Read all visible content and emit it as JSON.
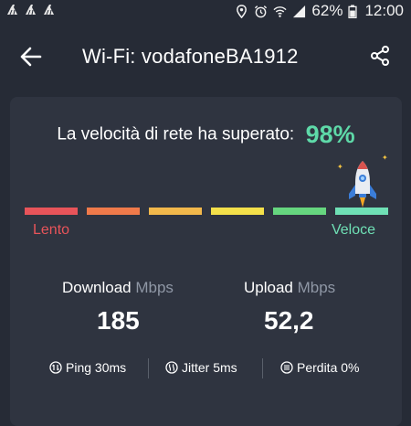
{
  "status_bar": {
    "notifications": [
      "cleaner-notification-icon",
      "cleaner-notification-icon",
      "cleaner-notification-icon"
    ],
    "icons": [
      "location-icon",
      "alarm-icon",
      "wifi-icon",
      "signal-icon"
    ],
    "battery": "62%",
    "time": "12:00"
  },
  "app_bar": {
    "title": "Wi-Fi: vodafoneBA1912",
    "back_icon": "back-arrow-icon",
    "share_icon": "share-icon"
  },
  "result": {
    "headline": "La velocità di rete ha superato:",
    "percentile": "98%",
    "meter": {
      "level": 0.98,
      "segment_colors": [
        "#e8545a",
        "#f07a4a",
        "#f2b84b",
        "#f4e04a",
        "#66d67f",
        "#6fe0b5"
      ]
    },
    "slow_label": "Lento",
    "fast_label": "Veloce"
  },
  "metrics": {
    "download": {
      "label": "Download",
      "unit": "Mbps",
      "value": "185"
    },
    "upload": {
      "label": "Upload",
      "unit": "Mbps",
      "value": "52,2"
    }
  },
  "stats": {
    "ping": {
      "icon": "ping-icon",
      "text": "Ping 30ms"
    },
    "jitter": {
      "icon": "jitter-icon",
      "text": "Jitter 5ms"
    },
    "loss": {
      "icon": "packet-loss-icon",
      "text": "Perdita 0%"
    }
  },
  "colors": {
    "background": "#262b36",
    "card": "#2f3440",
    "accent_green": "#5ed9a8",
    "slow_red": "#e8545a",
    "unit_gray": "#8f97a5"
  }
}
